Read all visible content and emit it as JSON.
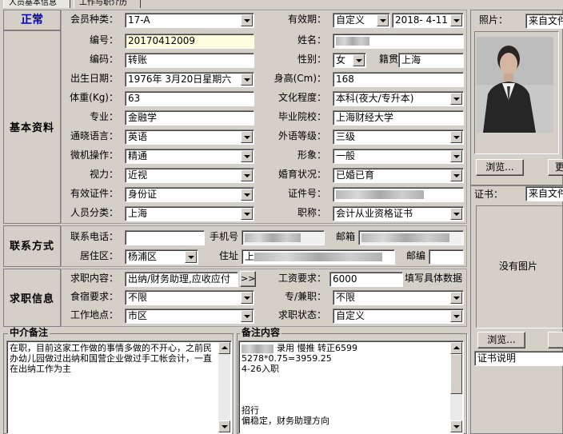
{
  "tabs": [
    "人员基本信息",
    "工作与职介历"
  ],
  "status": "正常",
  "sections": {
    "basic": "基本资料",
    "contact": "联系方式",
    "job": "求职信息"
  },
  "fields": {
    "member_type": {
      "label": "会员种类：",
      "value": "17-A"
    },
    "validity": {
      "label": "有效期：",
      "mode": "自定义",
      "date": "2018- 4-11"
    },
    "number": {
      "label": "编号：",
      "value": "20170412009"
    },
    "name": {
      "label": "姓名：",
      "value": ""
    },
    "code": {
      "label": "编码：",
      "value": "转账"
    },
    "gender": {
      "label": "性别：",
      "value": "女"
    },
    "origin": {
      "label": "籍贯",
      "value": "上海"
    },
    "birth": {
      "label": "出生日期：",
      "value": "1976年 3月20日星期六"
    },
    "height": {
      "label": "身高(Cm)：",
      "value": "168"
    },
    "weight": {
      "label": "体重(Kg)：",
      "value": "63"
    },
    "education": {
      "label": "文化程度：",
      "value": "本科(夜大/专升本)"
    },
    "major": {
      "label": "专业：",
      "value": "金融学"
    },
    "school": {
      "label": "毕业院校：",
      "value": "上海财经大学"
    },
    "language": {
      "label": "通晓语言：",
      "value": "英语"
    },
    "foreign_level": {
      "label": "外语等级：",
      "value": "三级"
    },
    "computer": {
      "label": "微机操作：",
      "value": "精通"
    },
    "appearance": {
      "label": "形象：",
      "value": "一般"
    },
    "vision": {
      "label": "视力：",
      "value": "近视"
    },
    "marital": {
      "label": "婚育状况：",
      "value": "已婚已育"
    },
    "id_type": {
      "label": "有效证件：",
      "value": "身份证"
    },
    "id_no": {
      "label": "证件号：",
      "value": ""
    },
    "category": {
      "label": "人员分类：",
      "value": "上海"
    },
    "title": {
      "label": "职称：",
      "value": "会计从业资格证书"
    },
    "phone": {
      "label": "联系电话：",
      "value": ""
    },
    "mobile": {
      "label": "手机号",
      "value": ""
    },
    "email": {
      "label": "邮箱",
      "value": ""
    },
    "district": {
      "label": "居住区：",
      "value": "杨浦区"
    },
    "address": {
      "label": "住址",
      "value": "上"
    },
    "postcode": {
      "label": "邮编",
      "value": ""
    },
    "job_content": {
      "label": "求职内容：",
      "value": "出纳/财务助理,应收应付"
    },
    "salary": {
      "label": "工资要求：",
      "value": "6000",
      "hint": "填写具体数据"
    },
    "lodging": {
      "label": "食宿要求：",
      "value": "不限"
    },
    "parttime": {
      "label": "专/兼职：",
      "value": "不限"
    },
    "location": {
      "label": "工作地点：",
      "value": "市区"
    },
    "job_status": {
      "label": "求职状态：",
      "value": "自定义"
    }
  },
  "agency_note": {
    "title": "中介备注",
    "text": "在职，目前这家工作做的事情多做的不开心，之前民办幼儿园做过出纳和国营企业做过手工帐会计，一直在出纳工作为主"
  },
  "remark": {
    "title": "备注内容",
    "lines": [
      "录用  慢推  转正6599",
      "5278*0.75=3959.25",
      "4-26入职",
      "",
      "",
      "",
      "招行",
      "偏稳定，财务助理方向"
    ]
  },
  "photo": {
    "label": "照片：",
    "source": "来自文件",
    "browse": "浏览..."
  },
  "cert": {
    "label": "证书：",
    "source": "来自文件",
    "empty": "没有图片",
    "browse": "浏览...",
    "caption": "证书说明"
  },
  "more_button": ">>"
}
